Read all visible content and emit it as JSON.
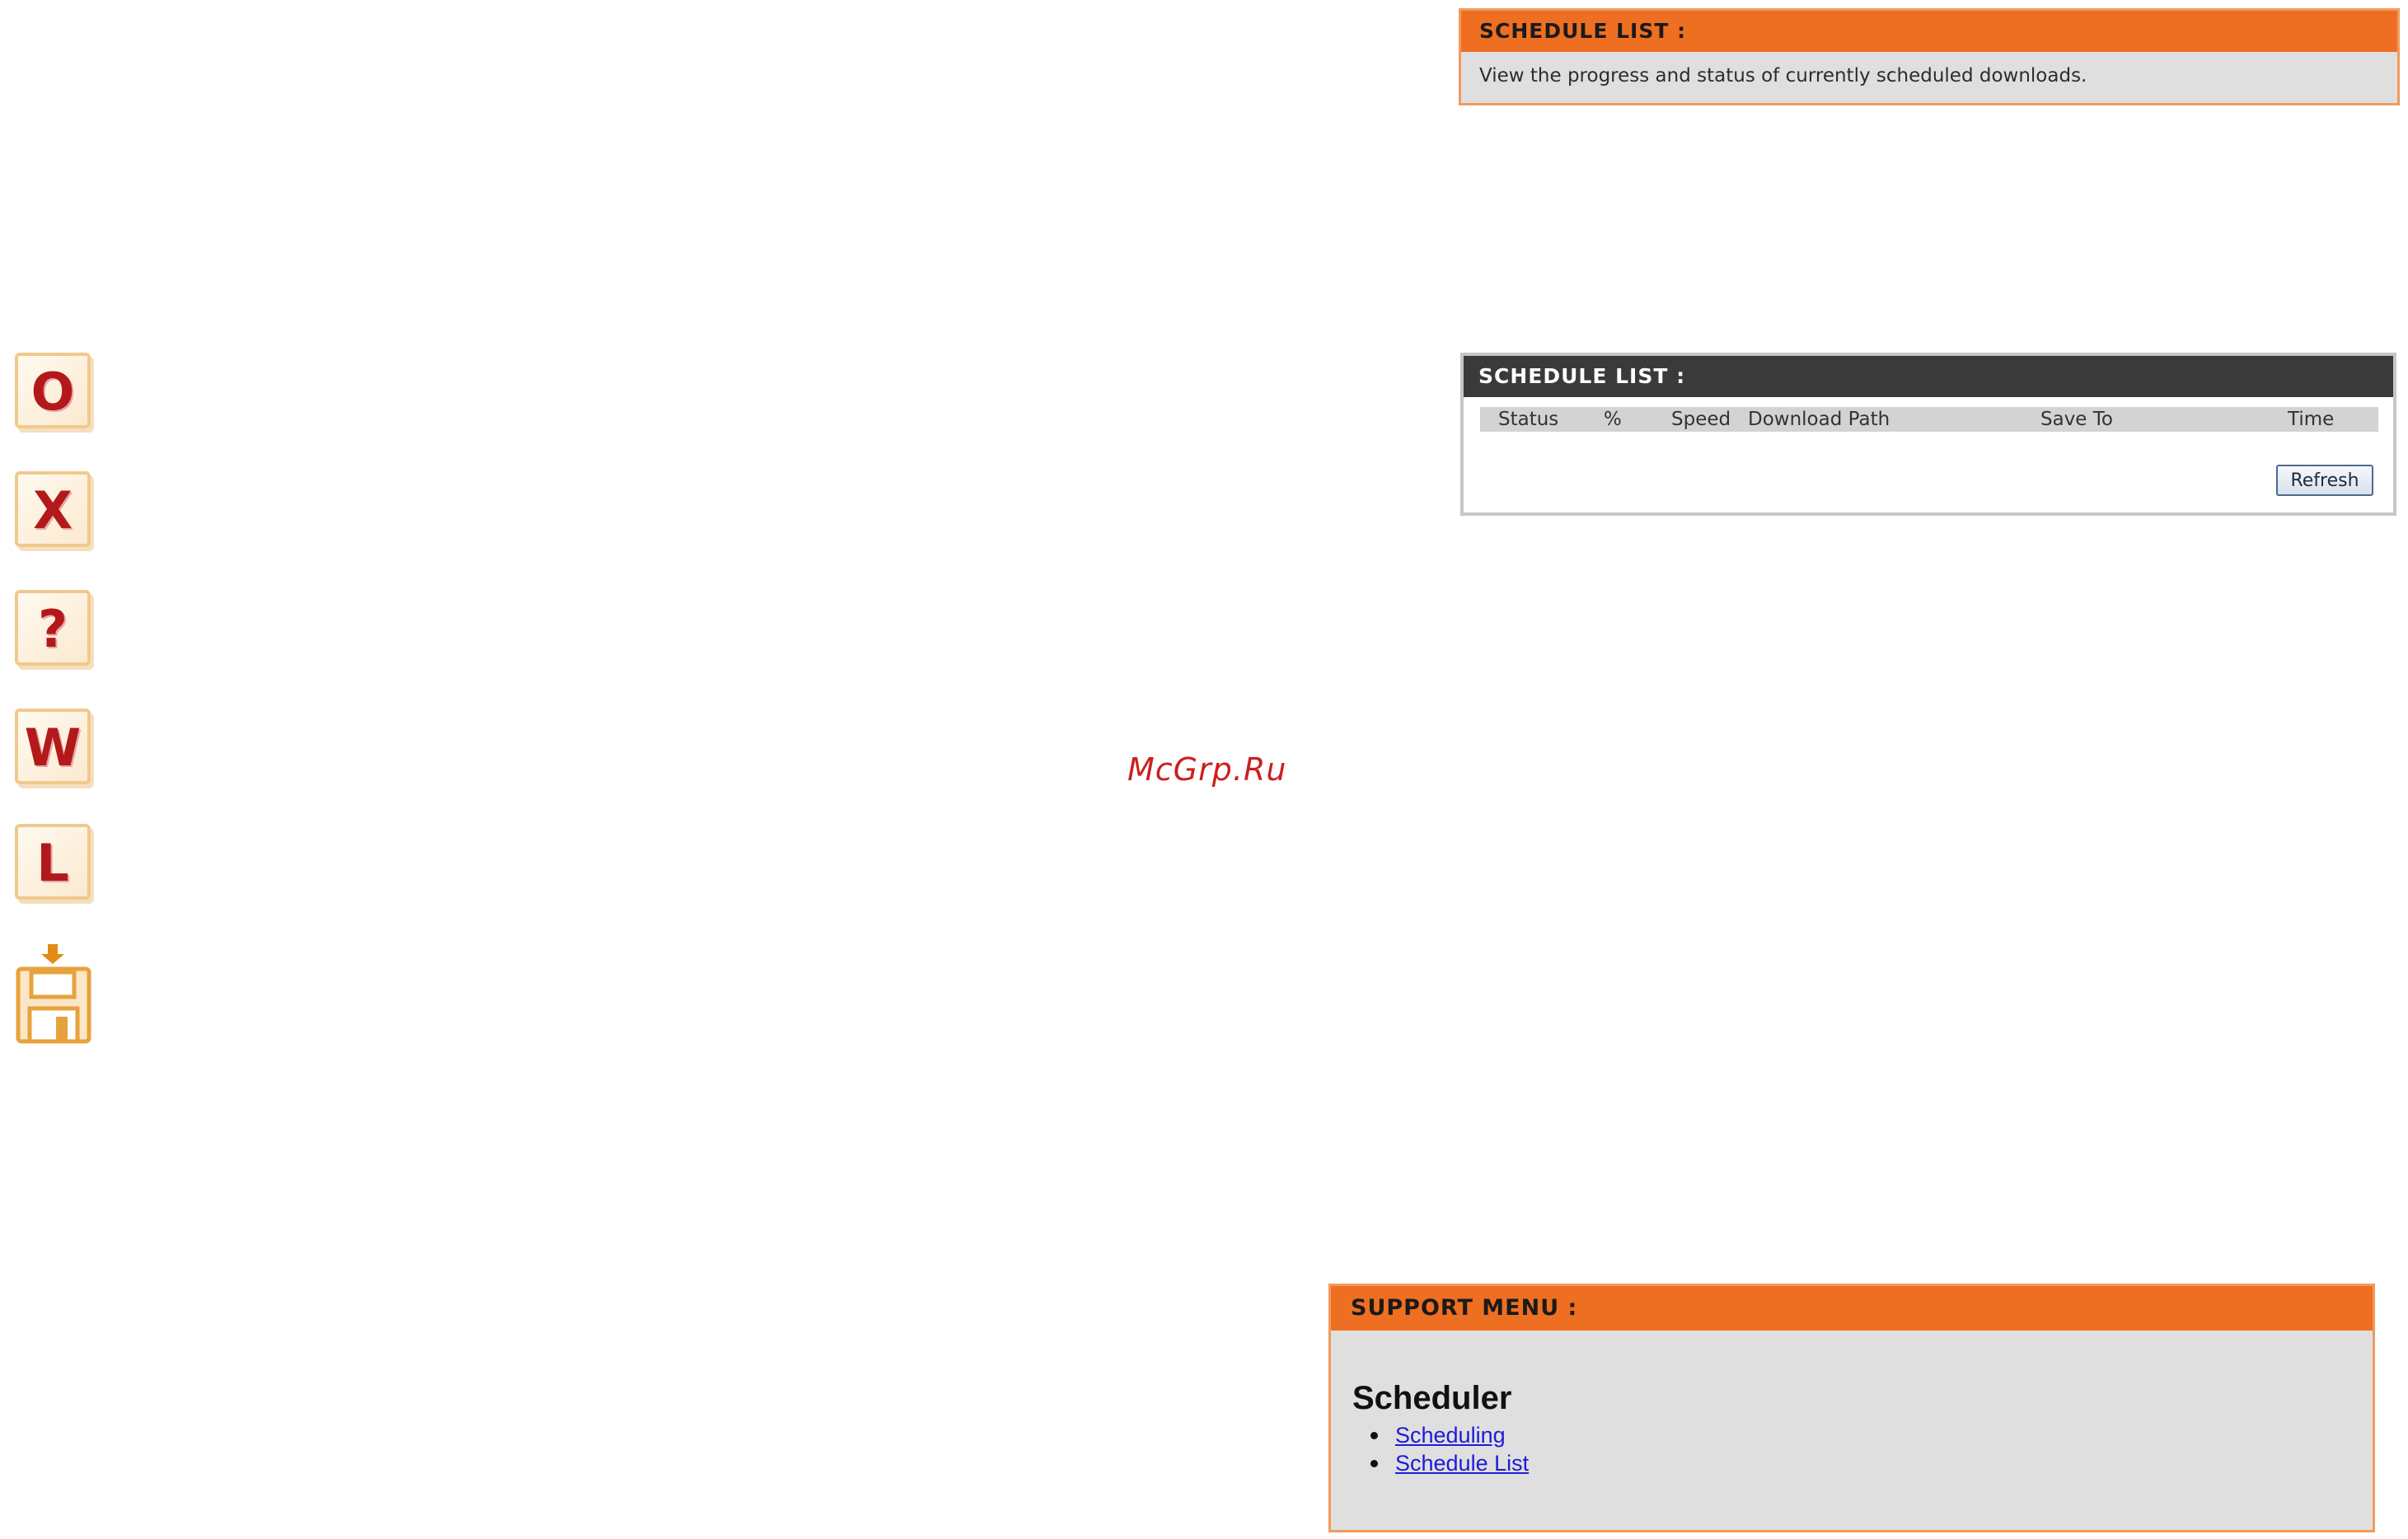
{
  "status_icons": [
    {
      "name": "ok",
      "glyph": "O"
    },
    {
      "name": "failed",
      "glyph": "X"
    },
    {
      "name": "unknown",
      "glyph": "?"
    },
    {
      "name": "waiting",
      "glyph": "W"
    },
    {
      "name": "downloading",
      "glyph": "L"
    },
    {
      "name": "save-icon"
    }
  ],
  "schedule_info": {
    "title": "SCHEDULE LIST :",
    "description": "View the progress and status of currently scheduled downloads."
  },
  "schedule_list": {
    "title": "SCHEDULE LIST :",
    "columns": [
      "Status",
      "%",
      "Speed",
      "Download Path",
      "Save To",
      "Time"
    ],
    "refresh_label": "Refresh"
  },
  "support_menu": {
    "title": "SUPPORT MENU :",
    "heading": "Scheduler",
    "links": [
      "Scheduling",
      "Schedule List"
    ]
  },
  "watermark": "McGrp.Ru",
  "colors": {
    "orange_header": "#ee6f21",
    "dark_header": "#3a3a3a",
    "panel_gray": "#dfdfdf",
    "icon_red": "#b3191b",
    "link_blue": "#1d1bd6"
  }
}
